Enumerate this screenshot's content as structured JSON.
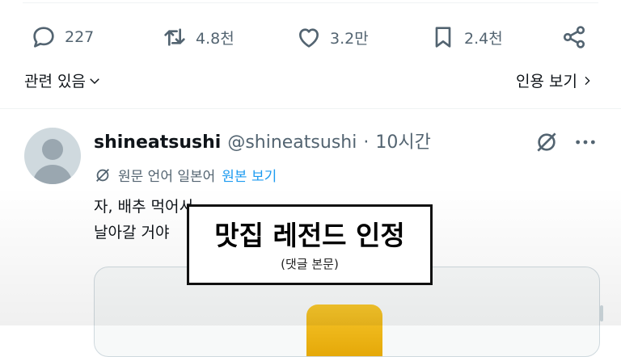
{
  "post_actions": {
    "replies": "227",
    "reposts": "4.8천",
    "likes": "3.2만",
    "bookmarks": "2.4천"
  },
  "related_label": "관련 있음",
  "quotes_label": "인용 보기",
  "reply": {
    "display_name": "shineatsushi",
    "handle": "@shineatsushi",
    "separator": "·",
    "time": "10시간",
    "translate_note": "원문 언어 일본어",
    "translate_link": "원본 보기",
    "text": "자, 배추 먹어서\n날아갈 거야"
  },
  "caption": {
    "title": "맛집 레전드 인정",
    "subtitle": "(댓글 본문)"
  },
  "colors": {
    "text": "#0f1419",
    "muted": "#536471",
    "link": "#1d9bf0",
    "media_accent": "#f7c62b"
  }
}
